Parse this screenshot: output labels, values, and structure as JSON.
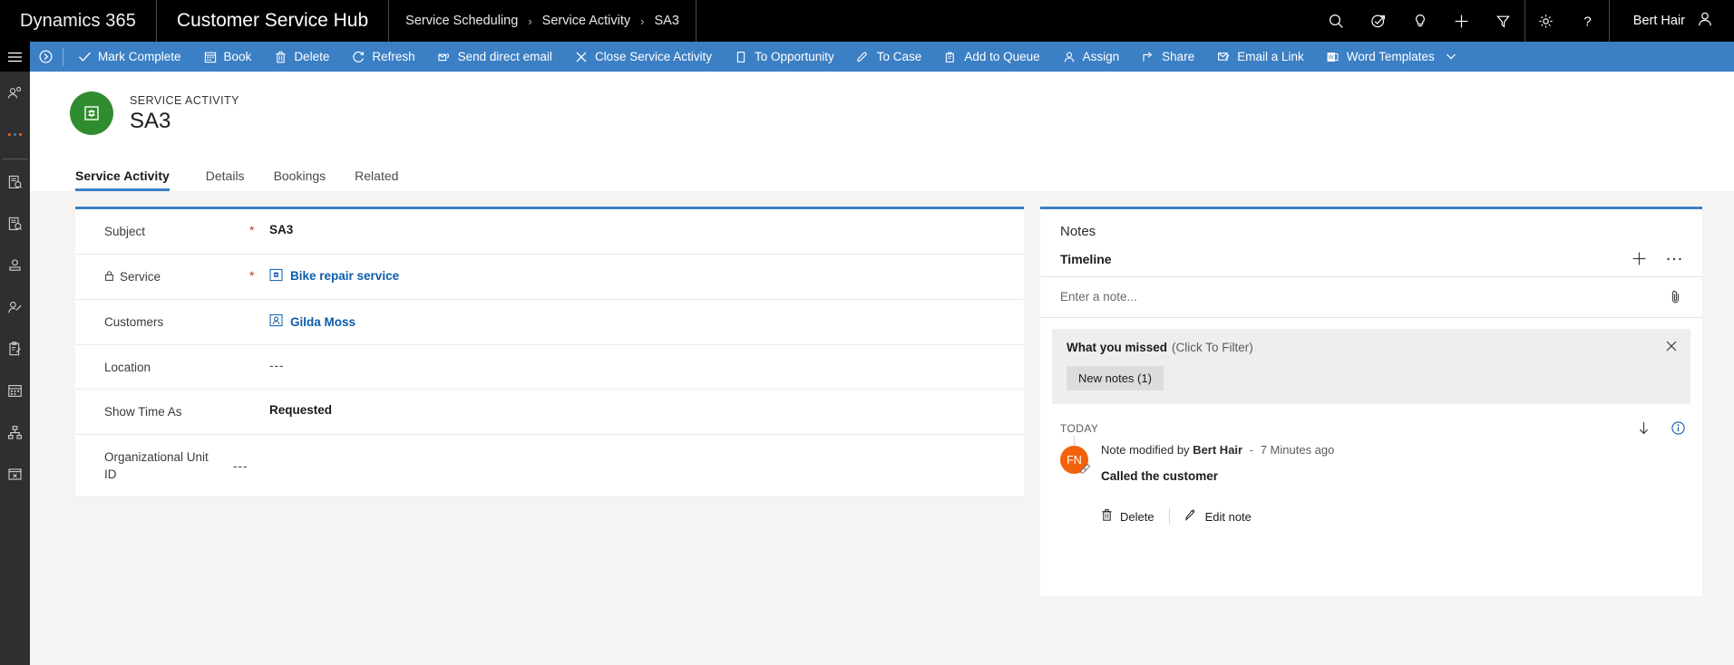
{
  "topnav": {
    "brand": "Dynamics 365",
    "app_title": "Customer Service Hub",
    "breadcrumb": [
      "Service Scheduling",
      "Service Activity",
      "SA3"
    ],
    "separator": "›",
    "icons": [
      {
        "name": "search-icon",
        "label": "Search"
      },
      {
        "name": "quick-create-check-icon",
        "label": "Quick actions"
      },
      {
        "name": "lightbulb-icon",
        "label": "Insights"
      },
      {
        "name": "plus-icon",
        "label": "New"
      },
      {
        "name": "filter-icon",
        "label": "Filter"
      }
    ],
    "settings_icons": [
      {
        "name": "gear-icon",
        "label": "Settings"
      },
      {
        "name": "help-icon",
        "label": "Help"
      }
    ],
    "user_name": "Bert Hair",
    "accent_color": "#3b7fc4"
  },
  "sidebar": {
    "hamburger_label": "Site map",
    "items": [
      {
        "name": "sidebar-item-recent",
        "label": "Recent"
      },
      {
        "name": "sidebar-item-more",
        "label": "More"
      },
      {
        "name": "sidebar-item-cases",
        "label": "Cases"
      },
      {
        "name": "sidebar-item-activities",
        "label": "Activities"
      },
      {
        "name": "sidebar-item-accounts",
        "label": "Accounts"
      },
      {
        "name": "sidebar-item-contacts",
        "label": "Contacts"
      },
      {
        "name": "sidebar-item-queues",
        "label": "Queues"
      },
      {
        "name": "sidebar-item-service-calendar",
        "label": "Service Calendar"
      },
      {
        "name": "sidebar-item-resource-groups",
        "label": "Resource Groups"
      },
      {
        "name": "sidebar-item-services",
        "label": "Services"
      }
    ]
  },
  "commandbar": {
    "overflow_label": "Command overflow",
    "buttons": [
      {
        "name": "mark-complete-button",
        "label": "Mark Complete",
        "icon": "check-icon"
      },
      {
        "name": "book-button",
        "label": "Book",
        "icon": "calendar-icon"
      },
      {
        "name": "delete-button",
        "label": "Delete",
        "icon": "trash-icon"
      },
      {
        "name": "refresh-button",
        "label": "Refresh",
        "icon": "refresh-icon"
      },
      {
        "name": "send-direct-email-button",
        "label": "Send direct email",
        "icon": "mail-send-icon"
      },
      {
        "name": "close-service-activity-button",
        "label": "Close Service Activity",
        "icon": "close-icon"
      },
      {
        "name": "to-opportunity-button",
        "label": "To Opportunity",
        "icon": "opportunity-icon"
      },
      {
        "name": "to-case-button",
        "label": "To Case",
        "icon": "case-icon"
      },
      {
        "name": "add-to-queue-button",
        "label": "Add to Queue",
        "icon": "queue-icon"
      },
      {
        "name": "assign-button",
        "label": "Assign",
        "icon": "person-icon"
      },
      {
        "name": "share-button",
        "label": "Share",
        "icon": "share-icon"
      },
      {
        "name": "email-a-link-button",
        "label": "Email a Link",
        "icon": "email-link-icon"
      },
      {
        "name": "word-templates-button",
        "label": "Word Templates",
        "icon": "word-icon",
        "has_chevron": true
      }
    ]
  },
  "record": {
    "kicker": "SERVICE ACTIVITY",
    "title": "SA3",
    "badge_color": "#2f8c2f",
    "badge_icon": "service-activity-icon"
  },
  "tabs": [
    {
      "name": "tab-service-activity",
      "label": "Service Activity",
      "active": true
    },
    {
      "name": "tab-details",
      "label": "Details",
      "active": false
    },
    {
      "name": "tab-bookings",
      "label": "Bookings",
      "active": false
    },
    {
      "name": "tab-related",
      "label": "Related",
      "active": false
    }
  ],
  "form": {
    "fields": [
      {
        "name": "field-subject",
        "label": "Subject",
        "required": true,
        "locked": false,
        "value": "SA3",
        "bold": true,
        "link": false,
        "icon": null
      },
      {
        "name": "field-service",
        "label": "Service",
        "required": true,
        "locked": true,
        "value": "Bike repair service",
        "bold": true,
        "link": true,
        "icon": "service-lookup-icon"
      },
      {
        "name": "field-customers",
        "label": "Customers",
        "required": false,
        "locked": false,
        "value": "Gilda Moss",
        "bold": true,
        "link": true,
        "icon": "contact-lookup-icon"
      },
      {
        "name": "field-location",
        "label": "Location",
        "required": false,
        "locked": false,
        "value": "---",
        "bold": false,
        "link": false,
        "icon": null
      },
      {
        "name": "field-show-time-as",
        "label": "Show Time As",
        "required": false,
        "locked": false,
        "value": "Requested",
        "bold": true,
        "link": false,
        "icon": null
      },
      {
        "name": "field-organizational-unit-id",
        "label": "Organizational Unit ID",
        "required": false,
        "locked": false,
        "value": "---",
        "bold": false,
        "link": false,
        "icon": null
      }
    ]
  },
  "notes": {
    "panel_title": "Notes",
    "timeline_label": "Timeline",
    "add_label": "Create a timeline record",
    "more_label": "More timeline commands",
    "note_placeholder": "Enter a note...",
    "attach_label": "Attach file",
    "what_you_missed": {
      "title": "What you missed",
      "hint": "(Click To Filter)",
      "chip": "New notes (1)",
      "close_label": "Dismiss"
    },
    "sort_label": "Sort",
    "info_label": "More information",
    "group_label": "TODAY",
    "entries": [
      {
        "avatar_initials": "FN",
        "avatar_color": "#f2610c",
        "meta_prefix": "Note modified by",
        "author": "Bert Hair",
        "separator": "-",
        "timestamp": "7 Minutes ago",
        "text": "Called the customer",
        "actions": [
          {
            "name": "delete-note-button",
            "label": "Delete",
            "icon": "trash-icon"
          },
          {
            "name": "edit-note-button",
            "label": "Edit note",
            "icon": "pencil-icon"
          }
        ]
      }
    ]
  }
}
